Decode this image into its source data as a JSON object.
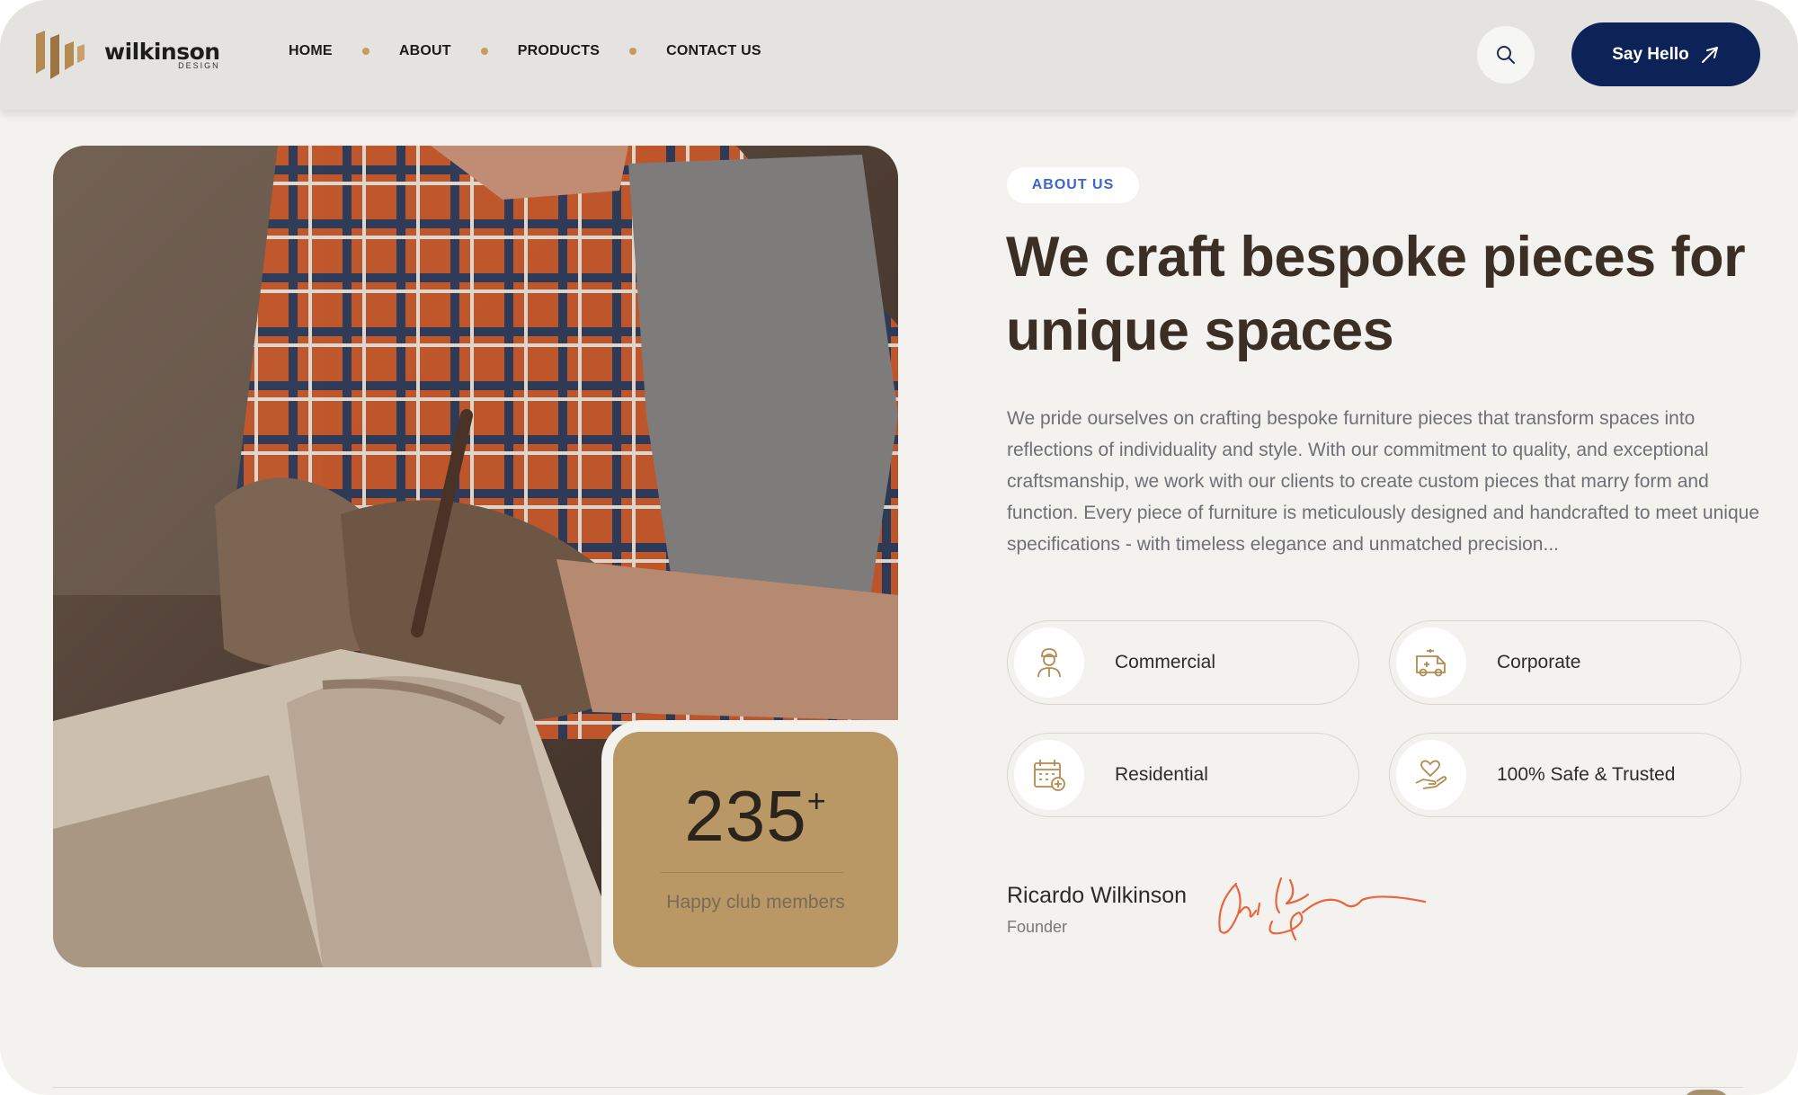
{
  "brand": {
    "name": "wilkinson",
    "sub": "DESIGN",
    "color": "#b48a50"
  },
  "nav": {
    "items": [
      "HOME",
      "ABOUT",
      "PRODUCTS",
      "CONTACT US"
    ]
  },
  "header": {
    "cta_label": "Say Hello",
    "search_icon": "search-icon",
    "cta_icon": "send-icon"
  },
  "colors": {
    "accent": "#c89b5e",
    "navy": "#0d2358",
    "heading": "#3b2e25",
    "badge_text": "#3a67c9",
    "stat_bg": "#b99865",
    "signature": "#e8653f"
  },
  "stat": {
    "number": "235",
    "suffix": "+",
    "label": "Happy club members"
  },
  "about": {
    "badge": "ABOUT US",
    "headline": "We craft bespoke pieces for unique spaces",
    "description": "We pride ourselves on crafting bespoke furniture pieces that transform spaces into reflections of individuality and style. With our commitment to quality, and exceptional craftsmanship, we work with our clients to create custom pieces that marry form and function. Every piece of furniture is meticulously designed and handcrafted to meet unique specifications - with timeless elegance and unmatched precision..."
  },
  "features": [
    {
      "label": "Commercial",
      "icon": "worker-icon"
    },
    {
      "label": "Corporate",
      "icon": "van-icon"
    },
    {
      "label": "Residential",
      "icon": "calendar-icon"
    },
    {
      "label": "100% Safe & Trusted",
      "icon": "hand-heart-icon"
    }
  ],
  "founder": {
    "name": "Ricardo Wilkinson",
    "role": "Founder"
  }
}
